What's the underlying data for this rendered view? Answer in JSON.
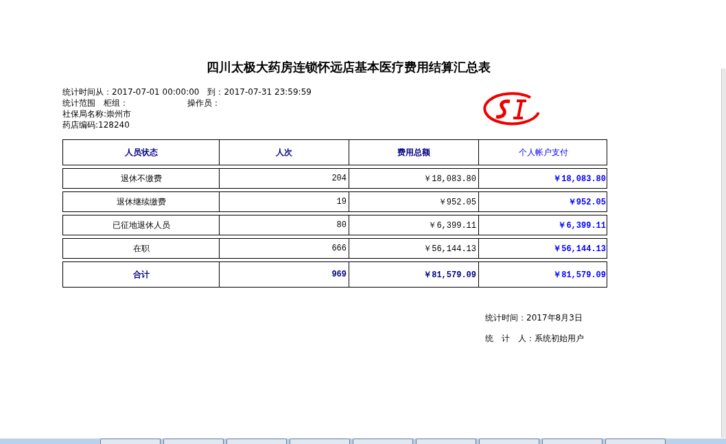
{
  "report": {
    "title": "四川太极大药房连锁怀远店基本医疗费用结算汇总表",
    "meta_rows": [
      [
        "统计时间从：2017-07-01 00:00:00",
        "到：2017-07-31 23:59:59"
      ],
      [
        "统计范围　柜组：",
        "操作员："
      ],
      [
        "社保局名称:崇州市"
      ],
      [
        "药店编码:128240"
      ]
    ],
    "table": {
      "columns": [
        "人员状态",
        "人次",
        "费用总额",
        "个人帐户支付"
      ],
      "rows": [
        [
          "退休不缴费",
          "204",
          "￥18,083.80",
          "￥18,083.80"
        ],
        [
          "退休继续缴费",
          "19",
          "￥952.05",
          "￥952.05"
        ],
        [
          "已征地退休人员",
          "80",
          "￥6,399.11",
          "￥6,399.11"
        ],
        [
          "在职",
          "666",
          "￥56,144.13",
          "￥56,144.13"
        ]
      ],
      "total": [
        "合计",
        "969",
        "￥81,579.09",
        "￥81,579.09"
      ]
    },
    "footer": [
      "统计时间：2017年8月3日",
      "统　计　人：系统初始用户"
    ]
  }
}
